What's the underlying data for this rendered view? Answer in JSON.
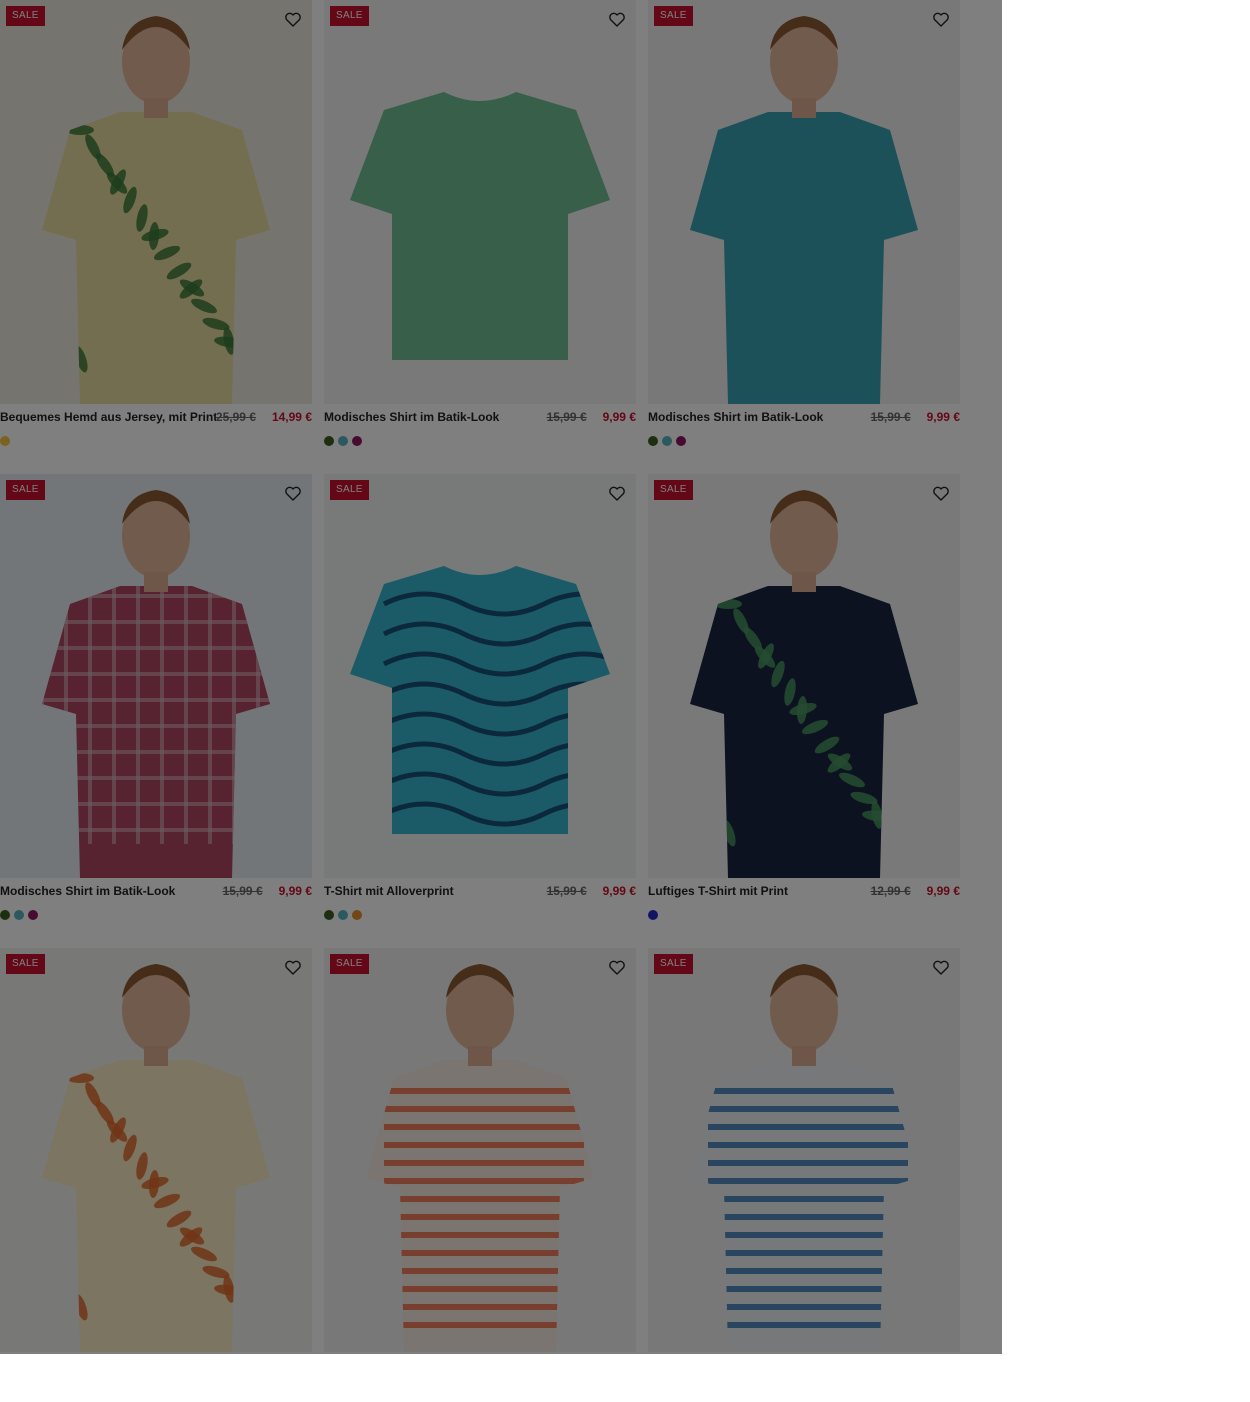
{
  "products": [
    {
      "badge": "SALE",
      "title": "Bequemes Hemd aus Jersey, mit Print",
      "old_price": "25,99 €",
      "price": "14,99 €",
      "swatches": [
        "#f4c542"
      ],
      "shirt_color": "#e8dca0",
      "accent": "#3a7a3a",
      "bg": "#ece9df",
      "pattern": "leaves",
      "model": true
    },
    {
      "badge": "SALE",
      "title": "Modisches Shirt im Batik-Look",
      "old_price": "15,99 €",
      "price": "9,99 €",
      "swatches": [
        "#3b5e1e",
        "#56b3c0",
        "#8e1463"
      ],
      "shirt_color": "#6fbf93",
      "accent": "#5aa882",
      "bg": "#f1f2f1",
      "pattern": "plain",
      "model": false
    },
    {
      "badge": "SALE",
      "title": "Modisches Shirt im Batik-Look",
      "old_price": "15,99 €",
      "price": "9,99 €",
      "swatches": [
        "#3b5e1e",
        "#56b3c0",
        "#8e1463"
      ],
      "shirt_color": "#3aa2b3",
      "accent": "#2f8a99",
      "bg": "#f1f1f1",
      "pattern": "plain",
      "model": true
    },
    {
      "badge": "SALE",
      "title": "Modisches Shirt im Batik-Look",
      "old_price": "15,99 €",
      "price": "9,99 €",
      "swatches": [
        "#3b5e1e",
        "#56b3c0",
        "#8e1463"
      ],
      "shirt_color": "#b04660",
      "accent": "#d9b7c4",
      "bg": "#e6edf0",
      "pattern": "check",
      "model": true
    },
    {
      "badge": "SALE",
      "title": "T-Shirt mit Alloverprint",
      "old_price": "15,99 €",
      "price": "9,99 €",
      "swatches": [
        "#3b5e1e",
        "#56b3c0",
        "#e88a2a"
      ],
      "shirt_color": "#34b6cf",
      "accent": "#103a5c",
      "bg": "#f1f2f2",
      "pattern": "swirl",
      "model": false
    },
    {
      "badge": "SALE",
      "title": "Luftiges T-Shirt mit Print",
      "old_price": "12,99 €",
      "price": "9,99 €",
      "swatches": [
        "#2828c8"
      ],
      "shirt_color": "#1a2440",
      "accent": "#4a9a62",
      "bg": "#f2f2f2",
      "pattern": "leaves",
      "model": true
    },
    {
      "badge": "SALE",
      "title": "",
      "old_price": "",
      "price": "",
      "swatches": [],
      "shirt_color": "#f6eac2",
      "accent": "#e26a2c",
      "bg": "#f0f0ef",
      "pattern": "leaves",
      "model": true
    },
    {
      "badge": "SALE",
      "title": "",
      "old_price": "",
      "price": "",
      "swatches": [],
      "shirt_color": "#f4ebe0",
      "accent": "#f06a44",
      "bg": "#f0f0f0",
      "pattern": "stripes",
      "model": true
    },
    {
      "badge": "SALE",
      "title": "",
      "old_price": "",
      "price": "",
      "swatches": [],
      "shirt_color": "#eef0f2",
      "accent": "#3a78b8",
      "bg": "#f0f0f0",
      "pattern": "stripes",
      "model": true
    }
  ],
  "icons": {
    "favorite": "heart-outline-icon"
  }
}
